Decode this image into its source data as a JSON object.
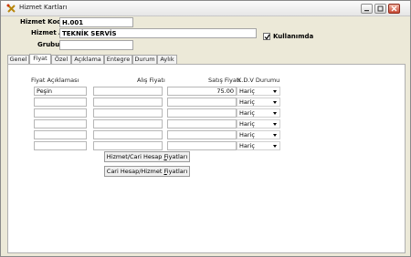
{
  "window": {
    "title": "Hizmet Kartları",
    "accent": "#ece9d8"
  },
  "form": {
    "code_label": "Hizmet Kodu",
    "code_value": "H.001",
    "name_label": "Hizmet Adı",
    "name_value": "TEKNİK SERVİS",
    "group_label": "Grubu",
    "group_value": "",
    "in_use_label": "Kullanımda",
    "in_use_checked": true
  },
  "tabs": [
    "Genel",
    "Fiyat",
    "Özel",
    "Açıklama",
    "Entegre",
    "Durum",
    "Aylık"
  ],
  "active_tab": "Fiyat",
  "grid": {
    "headers": {
      "desc": "Fiyat Açıklaması",
      "buy": "Alış Fiyatı",
      "sell": "Satış Fiyatı",
      "kdv": "K.D.V Durumu"
    },
    "rows": [
      {
        "desc": "Peşin",
        "buy": "",
        "sell": "75.00",
        "kdv": "Hariç"
      },
      {
        "desc": "",
        "buy": "",
        "sell": "",
        "kdv": "Hariç"
      },
      {
        "desc": "",
        "buy": "",
        "sell": "",
        "kdv": "Hariç"
      },
      {
        "desc": "",
        "buy": "",
        "sell": "",
        "kdv": "Hariç"
      },
      {
        "desc": "",
        "buy": "",
        "sell": "",
        "kdv": "Hariç"
      },
      {
        "desc": "",
        "buy": "",
        "sell": "",
        "kdv": "Hariç"
      }
    ]
  },
  "buttons": {
    "service_to_account_prefix": "Hizmet/Cari Hesap ",
    "service_to_account_u": "F",
    "service_to_account_suffix": "iyatları",
    "account_to_service_prefix": "Cari Hesap/Hizmet ",
    "account_to_service_u": "F",
    "account_to_service_suffix": "iyatları"
  }
}
